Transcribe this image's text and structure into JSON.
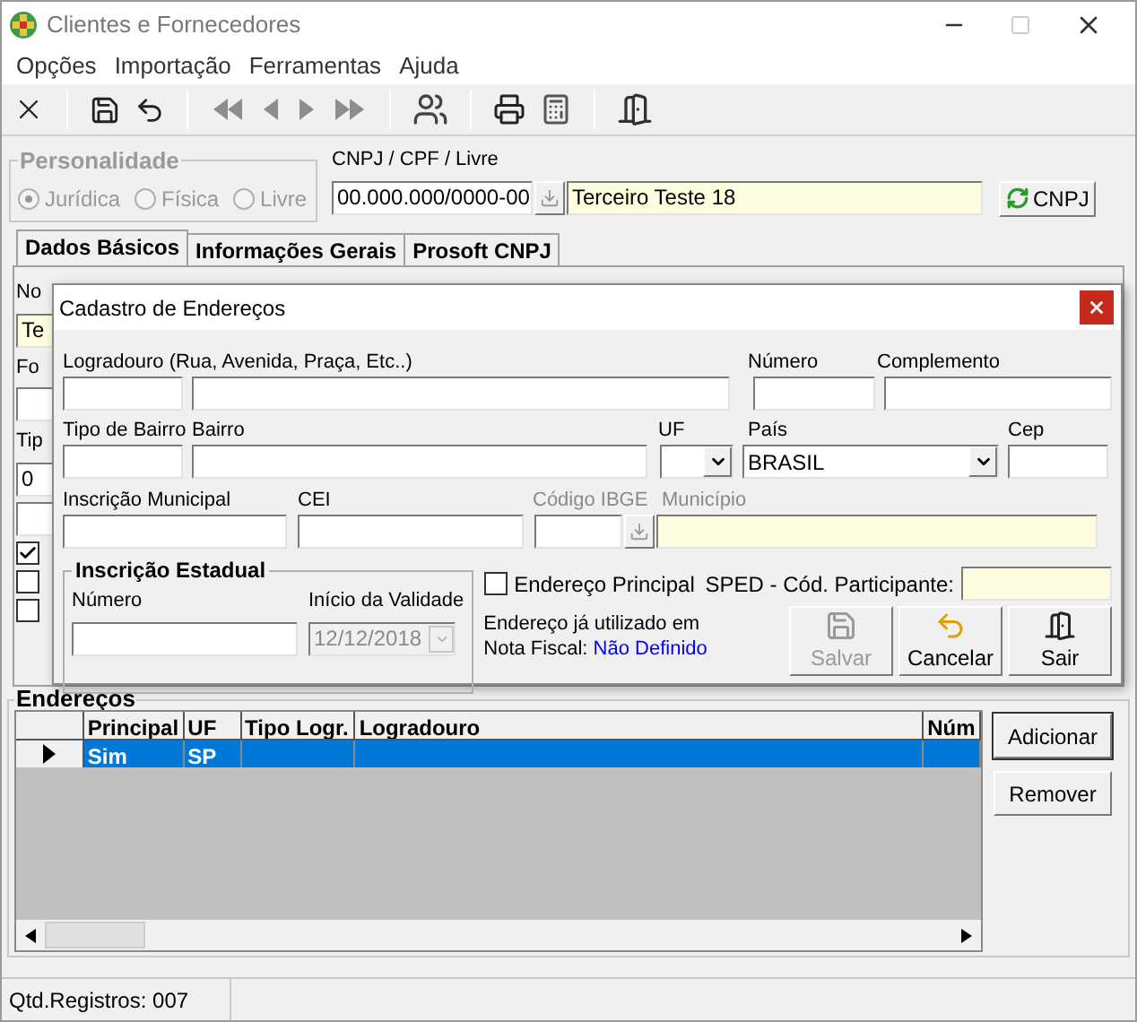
{
  "window": {
    "title": "Clientes e Fornecedores"
  },
  "menu": [
    "Opções",
    "Importação",
    "Ferramentas",
    "Ajuda"
  ],
  "personalidade": {
    "title": "Personalidade",
    "options": [
      {
        "label": "Jurídica",
        "selected": true
      },
      {
        "label": "Física",
        "selected": false
      },
      {
        "label": "Livre",
        "selected": false
      }
    ]
  },
  "document": {
    "label": "CNPJ / CPF / Livre",
    "value": "00.000.000/0000-00",
    "name": "Terceiro Teste 18",
    "button": "CNPJ"
  },
  "tabs": [
    {
      "label": "Dados Básicos",
      "selected": true
    },
    {
      "label": "Informações Gerais",
      "selected": false
    },
    {
      "label": "Prosoft CNPJ",
      "selected": false
    }
  ],
  "tab_fragments": [
    {
      "kind": "label",
      "text": "No"
    },
    {
      "kind": "field",
      "value": "Te"
    },
    {
      "kind": "label",
      "text": "Fo"
    },
    {
      "kind": "field"
    },
    {
      "kind": "label",
      "text": "Tip"
    },
    {
      "kind": "field",
      "value": "0"
    },
    {
      "kind": "field"
    },
    {
      "kind": "checkbox",
      "checked": true
    },
    {
      "kind": "checkbox",
      "checked": false
    },
    {
      "kind": "checkbox",
      "checked": false
    }
  ],
  "dialog": {
    "title": "Cadastro de Endereços",
    "logradouro_label": "Logradouro (Rua, Avenida, Praça, Etc..)",
    "numero_label": "Número",
    "complemento_label": "Complemento",
    "tipo_bairro_label": "Tipo de Bairro",
    "bairro_label": "Bairro",
    "uf_label": "UF",
    "pais_label": "País",
    "pais_value": "BRASIL",
    "cep_label": "Cep",
    "im_label": "Inscrição Municipal",
    "cei_label": "CEI",
    "ibge_label": "Código IBGE",
    "municipio_label": "Município",
    "ie": {
      "title": "Inscrição Estadual",
      "numero_label": "Número",
      "validade_label": "Início da Validade",
      "validade_value": "12/12/2018"
    },
    "principal": {
      "label": "Endereço Principal",
      "checked": false
    },
    "sped_label": "SPED - Cód. Participante:",
    "usage_label": "Endereço já utilizado em Nota Fiscal:",
    "usage_value": "Não Definido",
    "buttons": [
      {
        "label": "Salvar",
        "kind": "save",
        "disabled": true
      },
      {
        "label": "Cancelar",
        "kind": "cancel",
        "disabled": false
      },
      {
        "label": "Sair",
        "kind": "exit",
        "disabled": false
      }
    ]
  },
  "enderecos": {
    "title": "Endereços",
    "columns": [
      "Principal",
      "UF",
      "Tipo Logr.",
      "Logradouro",
      "Núm"
    ],
    "rows": [
      {
        "cells": [
          "Sim",
          "SP",
          "",
          "",
          ""
        ],
        "selected": true
      }
    ],
    "buttons": [
      "Adicionar",
      "Remover"
    ]
  },
  "status_bar": "Qtd.Registros: 007"
}
